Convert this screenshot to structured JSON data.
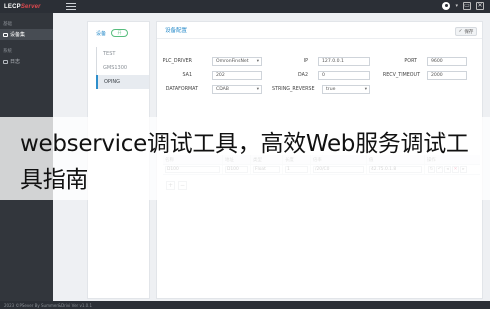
{
  "topbar": {
    "logo_main": "LECP",
    "logo_accent": "Server",
    "window_buttons": [
      "▭",
      "✕"
    ]
  },
  "sidebar": {
    "groups": [
      {
        "label": "基础",
        "items": [
          {
            "label": "设备集",
            "active": true
          }
        ]
      },
      {
        "label": "系统",
        "items": [
          {
            "label": "日志",
            "active": false
          }
        ]
      }
    ]
  },
  "subnav": {
    "title": "设备",
    "toggle_label": "开",
    "protocols": [
      {
        "label": "TEST",
        "active": false
      },
      {
        "label": "GMS1300",
        "active": false
      },
      {
        "label": "OPING",
        "active": true
      }
    ]
  },
  "panel": {
    "title": "设备配置",
    "save_label": "保存",
    "fields": {
      "plc_driver": {
        "label": "PLC_DRIVER",
        "value": "OmronFinsNet"
      },
      "ip": {
        "label": "IP",
        "value": "127.0.0.1"
      },
      "port": {
        "label": "PORT",
        "value": "9600"
      },
      "sa1": {
        "label": "SA1",
        "value": "202"
      },
      "da2": {
        "label": "DA2",
        "value": "0"
      },
      "recv_timeout": {
        "label": "RECV_TIMEOUT",
        "value": "2000"
      },
      "dataformat": {
        "label": "DATAFORMAT",
        "value": "CDAB"
      },
      "string_reverse": {
        "label": "STRING_REVERSE",
        "value": "true"
      }
    }
  },
  "table": {
    "headers": [
      "名称",
      "地址",
      "类型",
      "长度",
      "倍率",
      "值",
      "操作"
    ],
    "rows": [
      {
        "name": "D100",
        "address": "D100",
        "type": "Float",
        "length": "1",
        "rate": "/20/C0",
        "value": "42.75.0.1.8"
      }
    ],
    "add_buttons": [
      "+",
      "−"
    ]
  },
  "statusbar": {
    "text": "2023 ©PSever By Summer&Drivi Ver v1.0.1"
  },
  "banner": {
    "text": "webservice调试工具，高效Web服务调试工具指南"
  }
}
